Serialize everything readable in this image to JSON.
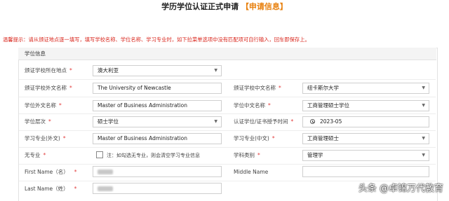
{
  "page": {
    "title": "学历学位认证正式申请",
    "title_highlight": "【申请信息】",
    "notice": "温馨提示：请从颁证地点逐一填写，填写学校名称、学位名称、学习专业时，如下拉菜单选项中没有匹配项可自行输入，回车即保存上。",
    "section_title": "学位信息"
  },
  "form": {
    "country": {
      "label": "颁证学校所在地点",
      "required": "*",
      "value": "澳大利亚"
    },
    "school_foreign": {
      "label": "颁证学校外文名称",
      "required": "*",
      "value": "The University of Newcastle"
    },
    "school_chinese": {
      "label": "颁证学校中文名称",
      "required": "*",
      "value": "纽卡斯尔大学"
    },
    "degree_foreign": {
      "label": "学位外文名称",
      "required": "*",
      "value": "Master of Business Administration"
    },
    "degree_chinese": {
      "label": "学位中文名称",
      "required": "*",
      "value": "工商管理硕士学位"
    },
    "degree_level": {
      "label": "学位层次",
      "required": "*",
      "value": "硕士学位"
    },
    "award_time": {
      "label": "认证学位/证书授予时间",
      "required": "*",
      "value": "2023-05"
    },
    "major_foreign": {
      "label": "学习专业(外文)",
      "required": "*",
      "value": "Master of Business Administration"
    },
    "major_chinese": {
      "label": "学习专业(中文)",
      "required": "*",
      "value": "工商管理硕士"
    },
    "no_major": {
      "label": "无专业",
      "required": "*",
      "note": "注：如勾选无专业，则会清空学习专业信息"
    },
    "discipline": {
      "label": "学科类别",
      "required": "*",
      "value": "管理学"
    },
    "first_name": {
      "label": "First Name（名）",
      "required": "*"
    },
    "middle_name": {
      "label": "Middle Name"
    },
    "last_name": {
      "label": "Last Name（姓）",
      "required": "*"
    }
  },
  "icons": {
    "dropdown": "chevron-down-icon",
    "time": "clock-icon"
  },
  "watermark": "头条 @卓锦万代教育",
  "colors": {
    "notice": "#d9261c",
    "highlight": "#e8810f",
    "required": "#e23b3b"
  }
}
